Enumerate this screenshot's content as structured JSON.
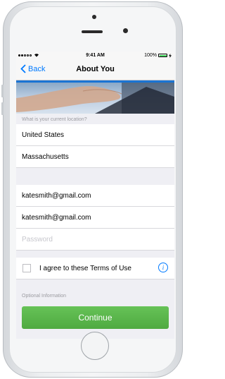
{
  "status_bar": {
    "carrier_dots": "●●○○○",
    "time": "9:41 AM",
    "battery": "100%"
  },
  "nav": {
    "back_label": "Back",
    "title": "About You"
  },
  "form": {
    "location_header": "What is your current location?",
    "country": "United States",
    "state": "Massachusetts",
    "email": "katesmith@gmail.com",
    "email_confirm": "katesmith@gmail.com",
    "password_placeholder": "Password",
    "terms_label": "I agree to these Terms of Use",
    "optional_header": "Optional Information"
  },
  "actions": {
    "continue_label": "Continue"
  },
  "colors": {
    "accent": "#007aff",
    "button": "#55b046",
    "hero_bar": "#1a74d3"
  }
}
